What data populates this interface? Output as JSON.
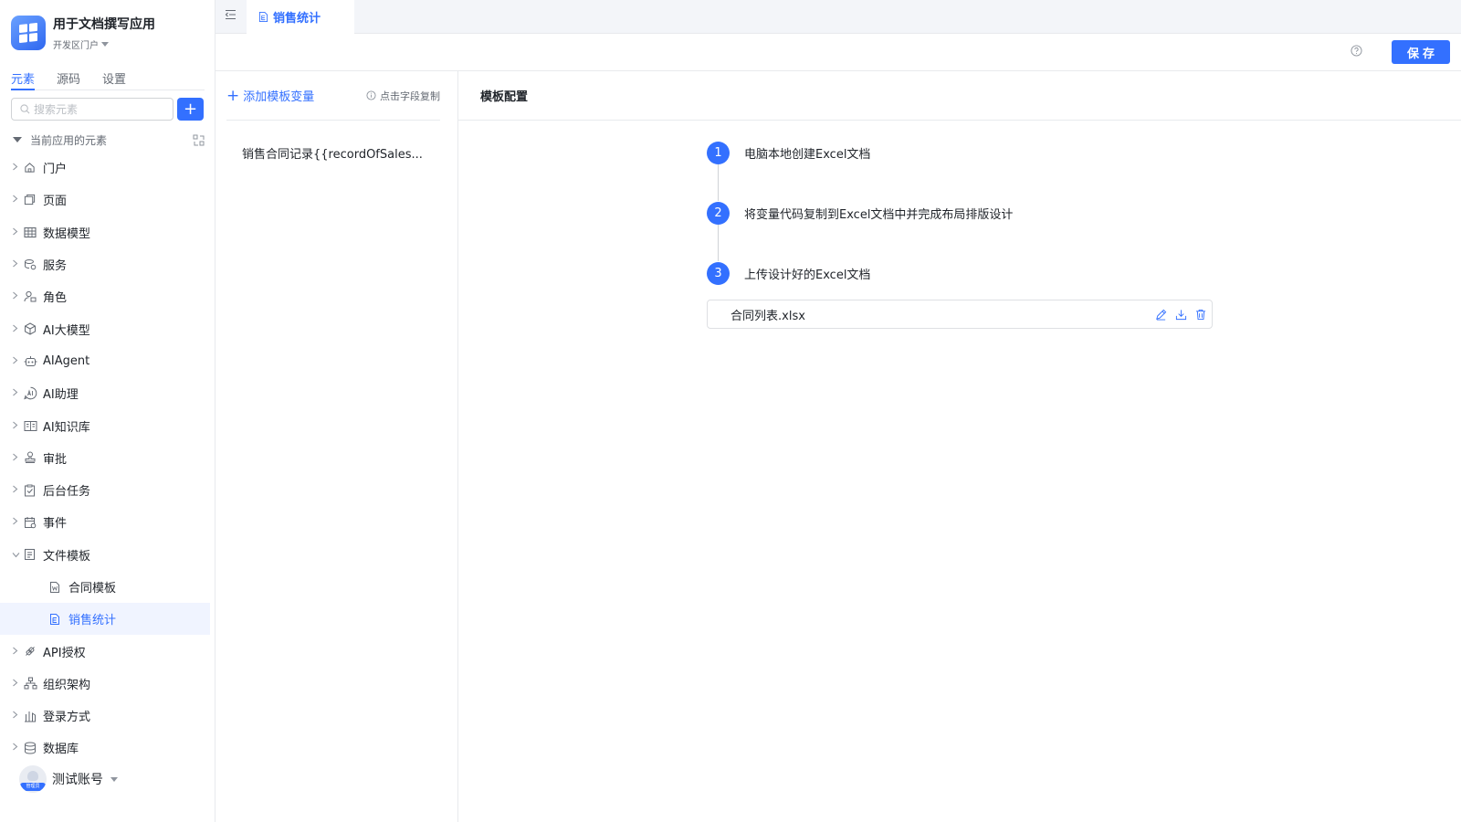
{
  "app": {
    "title": "用于文档撰写应用",
    "portal": "开发区门户"
  },
  "sidebar": {
    "tabs": [
      {
        "label": "元素",
        "active": true
      },
      {
        "label": "源码",
        "active": false
      },
      {
        "label": "设置",
        "active": false
      }
    ],
    "search_placeholder": "搜索元素",
    "add_label": "+",
    "tree_header": "当前应用的元素",
    "items": [
      {
        "label": "门户",
        "icon": "home-icon"
      },
      {
        "label": "页面",
        "icon": "page-icon"
      },
      {
        "label": "数据模型",
        "icon": "table-icon"
      },
      {
        "label": "服务",
        "icon": "service-icon"
      },
      {
        "label": "角色",
        "icon": "role-icon"
      },
      {
        "label": "AI大模型",
        "icon": "cube-icon"
      },
      {
        "label": "AIAgent",
        "icon": "robot-icon"
      },
      {
        "label": "AI助理",
        "icon": "ai-assistant-icon"
      },
      {
        "label": "AI知识库",
        "icon": "book-icon"
      },
      {
        "label": "审批",
        "icon": "stamp-icon"
      },
      {
        "label": "后台任务",
        "icon": "task-icon"
      },
      {
        "label": "事件",
        "icon": "event-icon"
      },
      {
        "label": "文件模板",
        "icon": "file-template-icon",
        "expanded": true
      },
      {
        "label": "合同模板",
        "icon": "word-file-icon",
        "child": true
      },
      {
        "label": "销售统计",
        "icon": "excel-file-icon",
        "child": true,
        "selected": true
      },
      {
        "label": "API授权",
        "icon": "api-icon"
      },
      {
        "label": "组织架构",
        "icon": "org-icon"
      },
      {
        "label": "登录方式",
        "icon": "login-icon"
      },
      {
        "label": "数据库",
        "icon": "database-icon"
      }
    ],
    "user": {
      "name": "测试账号",
      "badge": "管理员"
    }
  },
  "tabs": {
    "active_tab": "销售统计"
  },
  "toolbar": {
    "save_label": "保存"
  },
  "variables": {
    "add_label": "添加模板变量",
    "copy_hint": "点击字段复制",
    "items": [
      "销售合同记录{{recordOfSales..."
    ]
  },
  "config": {
    "title": "模板配置",
    "steps": [
      {
        "num": "1",
        "text": "电脑本地创建Excel文档"
      },
      {
        "num": "2",
        "text": "将变量代码复制到Excel文档中并完成布局排版设计"
      },
      {
        "num": "3",
        "text": "上传设计好的Excel文档"
      }
    ],
    "file_name": "合同列表.xlsx"
  },
  "colors": {
    "accent": "#3370ff",
    "selected_bg": "#f0f4ff",
    "border": "#e8eaed"
  }
}
